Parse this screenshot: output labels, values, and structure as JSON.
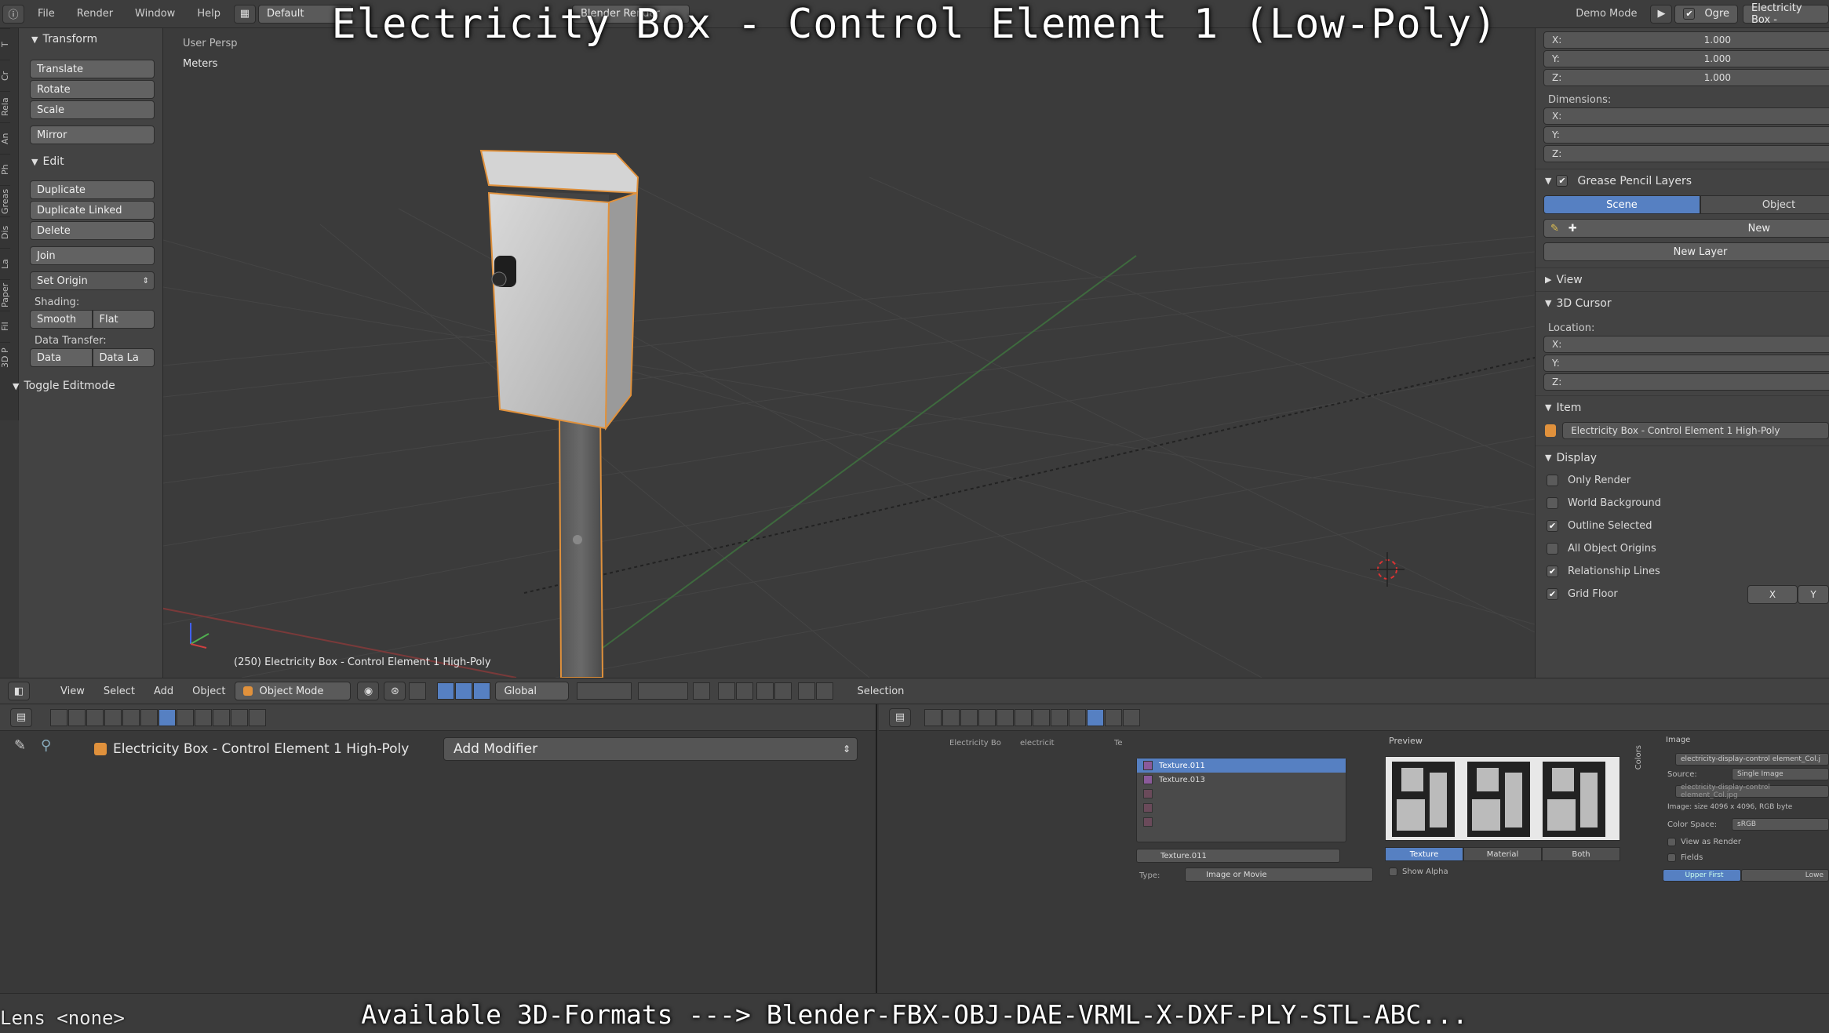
{
  "overlay": {
    "title": "Electricity Box - Control Element 1 (Low-Poly)",
    "formats": "Available 3D-Formats ---> Blender-FBX-OBJ-DAE-VRML-X-DXF-PLY-STL-ABC...",
    "lens": "Lens <none>"
  },
  "topbar": {
    "menus": [
      "File",
      "Render",
      "Window",
      "Help"
    ],
    "layout": "Default",
    "engine": "Blender Render",
    "mode_label": "Demo Mode",
    "user": "Ogre",
    "scene_name": "Electricity Box -"
  },
  "toolshelf": {
    "tabs": [
      "T",
      "Cr",
      "Rela",
      "An",
      "Ph",
      "Greas",
      "Dis",
      "La",
      "Paper",
      "Fil",
      "3D P"
    ],
    "transform_header": "Transform",
    "translate": "Translate",
    "rotate": "Rotate",
    "scale": "Scale",
    "mirror": "Mirror",
    "edit_header": "Edit",
    "duplicate": "Duplicate",
    "duplicate_linked": "Duplicate Linked",
    "delete": "Delete",
    "join": "Join",
    "set_origin": "Set Origin",
    "shading_label": "Shading:",
    "smooth": "Smooth",
    "flat": "Flat",
    "data_transfer_label": "Data Transfer:",
    "data": "Data",
    "data_la": "Data La",
    "toggle_editmode": "Toggle Editmode"
  },
  "viewport": {
    "persp": "User Persp",
    "units": "Meters",
    "object_info": "(250) Electricity Box - Control Element 1 High-Poly"
  },
  "props": {
    "scale_x_label": "X:",
    "scale_x": "1.000",
    "scale_y_label": "Y:",
    "scale_y": "1.000",
    "scale_z_label": "Z:",
    "scale_z": "1.000",
    "dimensions_label": "Dimensions:",
    "dim_x": "X:",
    "dim_y": "Y:",
    "dim_z": "Z:",
    "grease_header": "Grease Pencil Layers",
    "tab_scene": "Scene",
    "tab_object": "Object",
    "new": "New",
    "new_layer": "New Layer",
    "view_header": "View",
    "cursor_header": "3D Cursor",
    "location_label": "Location:",
    "loc_x": "X:",
    "loc_y": "Y:",
    "loc_z": "Z:",
    "item_header": "Item",
    "item_name": "Electricity Box - Control Element 1 High-Poly",
    "display_header": "Display",
    "only_render": "Only Render",
    "world_background": "World Background",
    "outline_selected": "Outline Selected",
    "all_object_origins": "All Object Origins",
    "relationship_lines": "Relationship Lines",
    "grid_floor": "Grid Floor",
    "grid_x": "X",
    "grid_y": "Y"
  },
  "vheader": {
    "view": "View",
    "select": "Select",
    "add": "Add",
    "object": "Object",
    "mode": "Object Mode",
    "orientation": "Global",
    "selection": "Selection"
  },
  "modifiers": {
    "object_name": "Electricity Box - Control Element 1 High-Poly",
    "add_modifier": "Add Modifier"
  },
  "texture": {
    "crumb1": "Electricity Bo",
    "crumb2": "electricit",
    "crumb3": "Te",
    "slots": [
      "Texture.011",
      "Texture.013"
    ],
    "tex_name": "Texture.011",
    "type_label": "Type:",
    "type_value": "Image or Movie",
    "preview_label": "Preview",
    "preview_tabs": [
      "Texture",
      "Material",
      "Both"
    ],
    "show_alpha": "Show Alpha"
  },
  "image": {
    "header": "Image",
    "file": "electricity-display-control element_Col.j",
    "source_label": "Source:",
    "source_value": "Single Image",
    "path": "electricity-display-control element_Col.jpg",
    "size": "Image: size 4096 x 4096, RGB byte",
    "colorspace_label": "Color Space:",
    "colorspace_value": "sRGB",
    "view_as_render": "View as Render",
    "fields": "Fields",
    "upper_first": "Upper First",
    "lower": "Lowe",
    "colors_tab": "Colors"
  },
  "colors": {
    "accent": "#5680c2",
    "selected_outline": "#e0913c",
    "background": "#393939"
  }
}
